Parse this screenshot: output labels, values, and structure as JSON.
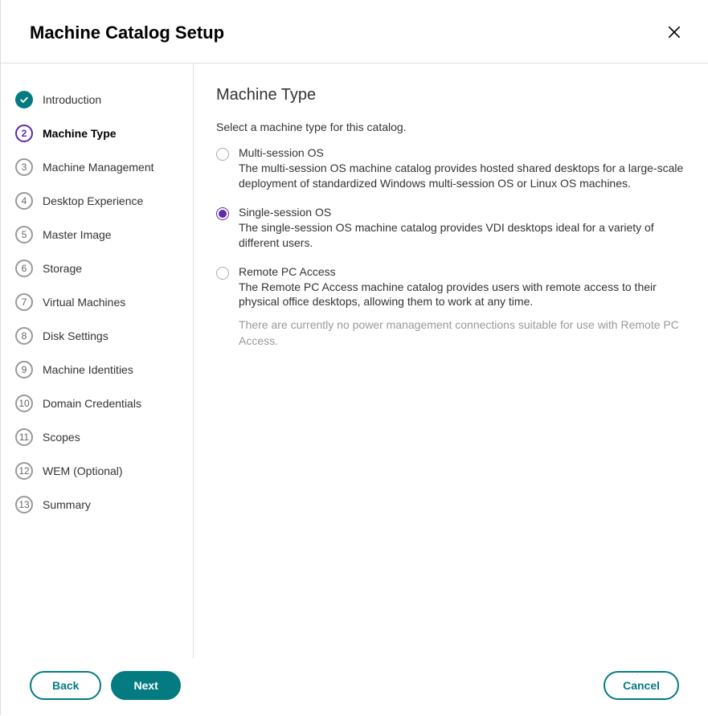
{
  "header": {
    "title": "Machine Catalog Setup"
  },
  "sidebar": {
    "steps": [
      {
        "number": "",
        "label": "Introduction",
        "state": "completed"
      },
      {
        "number": "2",
        "label": "Machine Type",
        "state": "active"
      },
      {
        "number": "3",
        "label": "Machine Management",
        "state": "pending"
      },
      {
        "number": "4",
        "label": "Desktop Experience",
        "state": "pending"
      },
      {
        "number": "5",
        "label": "Master Image",
        "state": "pending"
      },
      {
        "number": "6",
        "label": "Storage",
        "state": "pending"
      },
      {
        "number": "7",
        "label": "Virtual Machines",
        "state": "pending"
      },
      {
        "number": "8",
        "label": "Disk Settings",
        "state": "pending"
      },
      {
        "number": "9",
        "label": "Machine Identities",
        "state": "pending"
      },
      {
        "number": "10",
        "label": "Domain Credentials",
        "state": "pending"
      },
      {
        "number": "11",
        "label": "Scopes",
        "state": "pending"
      },
      {
        "number": "12",
        "label": "WEM (Optional)",
        "state": "pending"
      },
      {
        "number": "13",
        "label": "Summary",
        "state": "pending"
      }
    ]
  },
  "main": {
    "title": "Machine Type",
    "subtitle": "Select a machine type for this catalog.",
    "options": [
      {
        "label": "Multi-session OS",
        "desc": "The multi-session OS machine catalog provides hosted shared desktops for a large-scale deployment of standardized Windows multi-session OS or Linux OS machines.",
        "selected": false
      },
      {
        "label": "Single-session OS",
        "desc": "The single-session OS machine catalog provides VDI desktops ideal for a variety of different users.",
        "selected": true
      },
      {
        "label": "Remote PC Access",
        "desc": "The Remote PC Access machine catalog provides users with remote access to their physical office desktops, allowing them to work at any time.",
        "note": "There are currently no power management connections suitable for use with Remote PC Access.",
        "selected": false
      }
    ]
  },
  "footer": {
    "back": "Back",
    "next": "Next",
    "cancel": "Cancel"
  }
}
